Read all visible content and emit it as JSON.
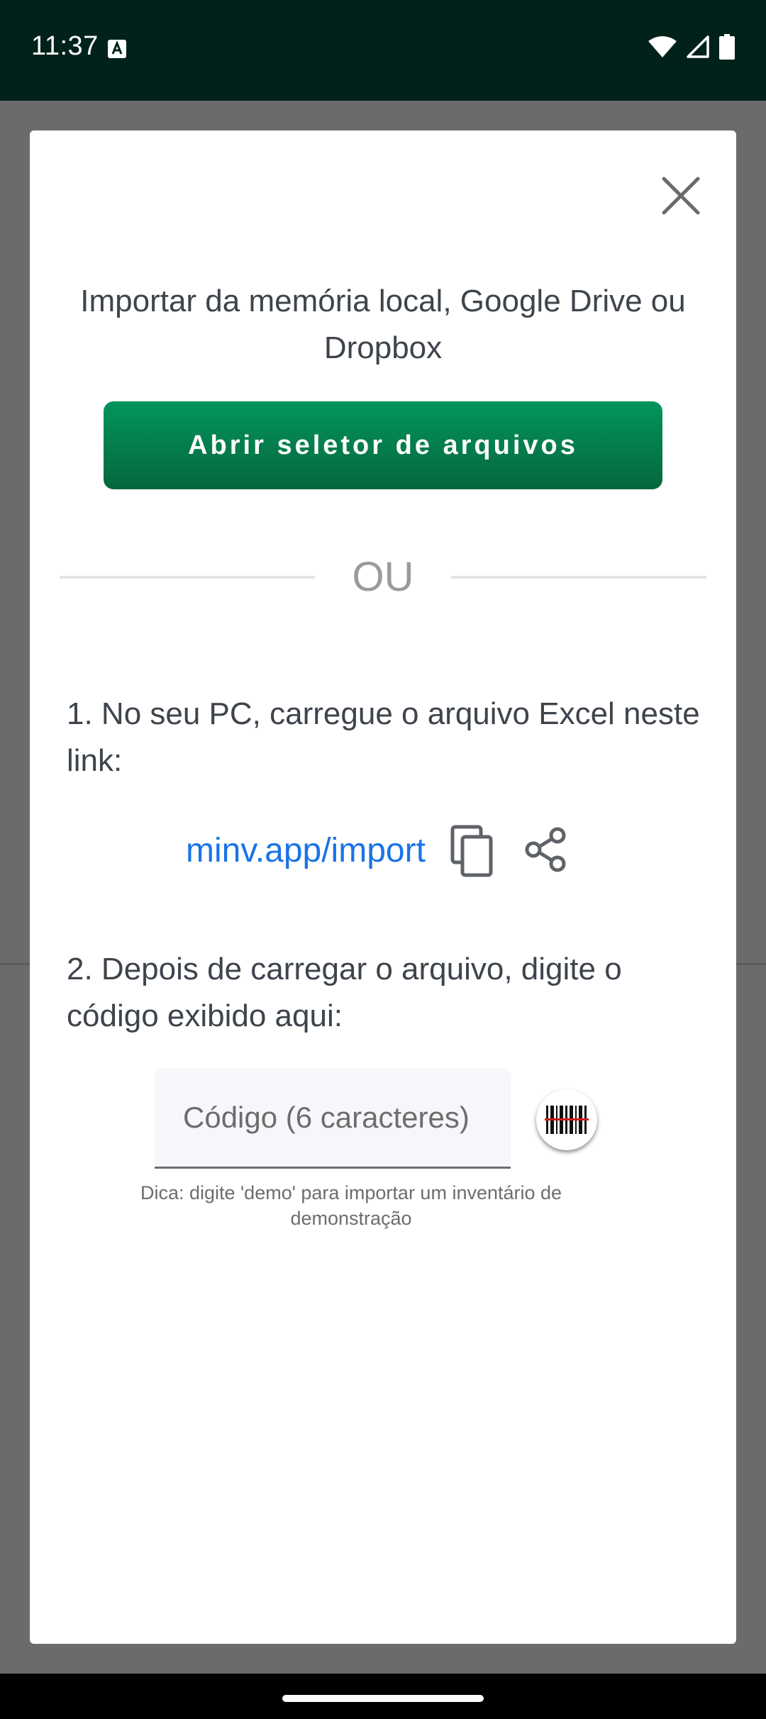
{
  "status_bar": {
    "time": "11:37",
    "icons": [
      "keyboard-a-icon",
      "wifi-icon",
      "cell-signal-icon",
      "battery-icon"
    ]
  },
  "dialog": {
    "title": "Importar da memória local, Google Drive ou Dropbox",
    "open_picker_label": "Abrir seletor de arquivos",
    "or_label": "OU",
    "step1": "1. No seu PC, carregue o arquivo Excel neste link:",
    "link": "minv.app/import",
    "step2": "2. Depois de carregar o arquivo, digite o código exibido aqui:",
    "code_placeholder": "Código (6 caracteres)",
    "code_value": "",
    "hint": "Dica: digite 'demo' para importar um inventário de demonstração"
  },
  "colors": {
    "status_bar_bg": "#00221a",
    "button_gradient_top": "#04945c",
    "button_gradient_bottom": "#05673c",
    "link": "#1a73e8",
    "text": "#3e444c",
    "scan_line": "#d11b1b"
  }
}
